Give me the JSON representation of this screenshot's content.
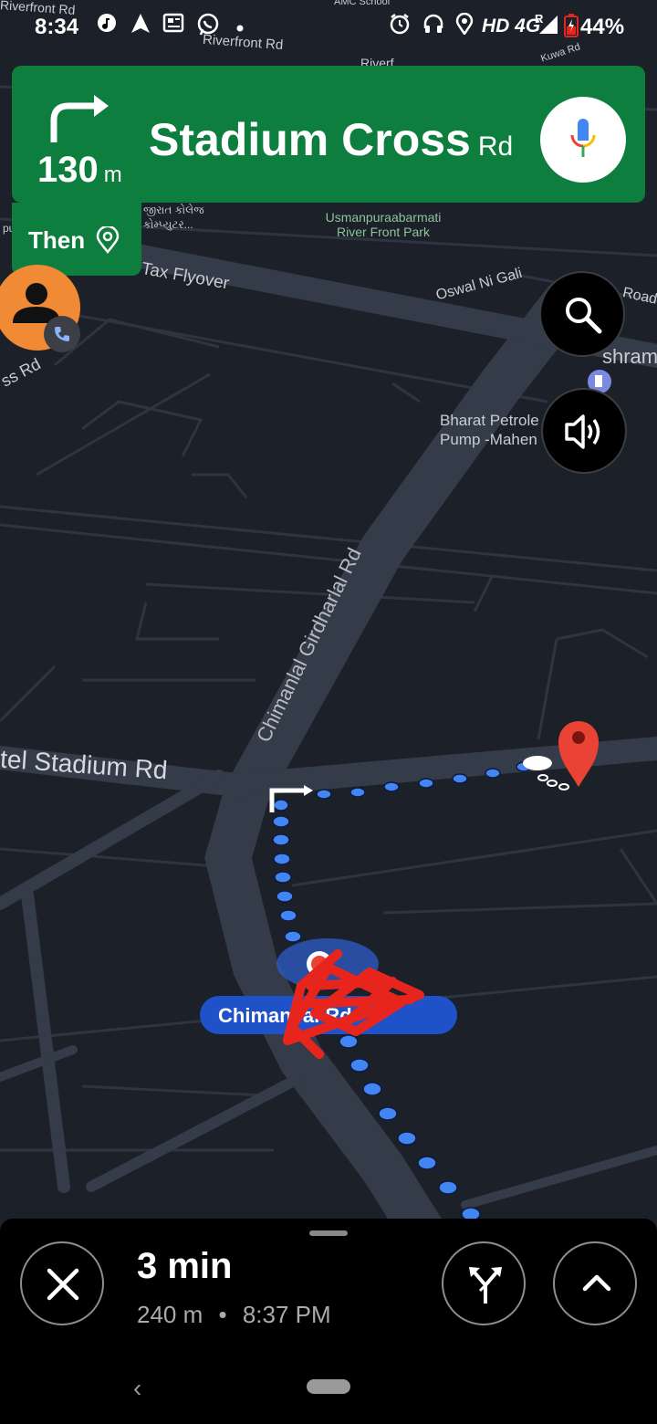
{
  "status_bar": {
    "time": "8:34",
    "network": "HD 4G",
    "signal_sup": "R",
    "battery": "44%",
    "icons": [
      "music-app-icon",
      "navigation-icon",
      "news-icon",
      "whatsapp-icon",
      "dot-icon",
      "alarm-icon",
      "headphones-icon",
      "location-icon",
      "signal-icon",
      "battery-icon"
    ]
  },
  "instruction": {
    "maneuver": "turn-right",
    "distance_value": "130",
    "distance_unit": "m",
    "street_main": "Stadium Cross",
    "street_suffix": "Rd"
  },
  "then_chip": {
    "label": "Then",
    "icon": "destination-pin-icon"
  },
  "map_labels": {
    "riverfront_top": "Riverfront Rd",
    "riverfront_2": "Riverfront Rd",
    "riverf": "Riverf",
    "amc_school": "AMC School",
    "kuwa_rd": "Kuwa Rd",
    "gujarati_college": "જીરાત કોલેજ",
    "gujarati_computer": "કોમ્પ્યુટર...",
    "usmanpura_1": "Usmanpuraabarmati",
    "usmanpura_2": "River Front Park",
    "tax_flyover": "Tax Flyover",
    "oswal": "Oswal Ni Gali",
    "road_right": "Road",
    "ashram": "shram",
    "ss_rd": "ss Rd",
    "bharat_1": "Bharat Petrole",
    "bharat_2": "Pump -Mahen",
    "chimanlal": "Chimanlal Girdharlal Rd",
    "stadium_rd": "tel Stadium Rd",
    "pu": "pu"
  },
  "current_road_pill": "Chimanl        al Rd",
  "trip": {
    "eta_minutes": "3 min",
    "remaining_distance": "240 m",
    "separator": "•",
    "arrival_time": "8:37 PM"
  },
  "colors": {
    "banner_green": "#0d7e3e",
    "route_blue": "#4285f4",
    "map_bg": "#1c2028",
    "destination_red": "#ea4335",
    "avatar_orange": "#f08a35"
  },
  "buttons": {
    "mic": "microphone-icon",
    "search": "search-icon",
    "sound": "sound-icon",
    "exit": "close-icon",
    "alt_routes": "alternate-routes-icon",
    "expand": "chevron-up-icon"
  }
}
